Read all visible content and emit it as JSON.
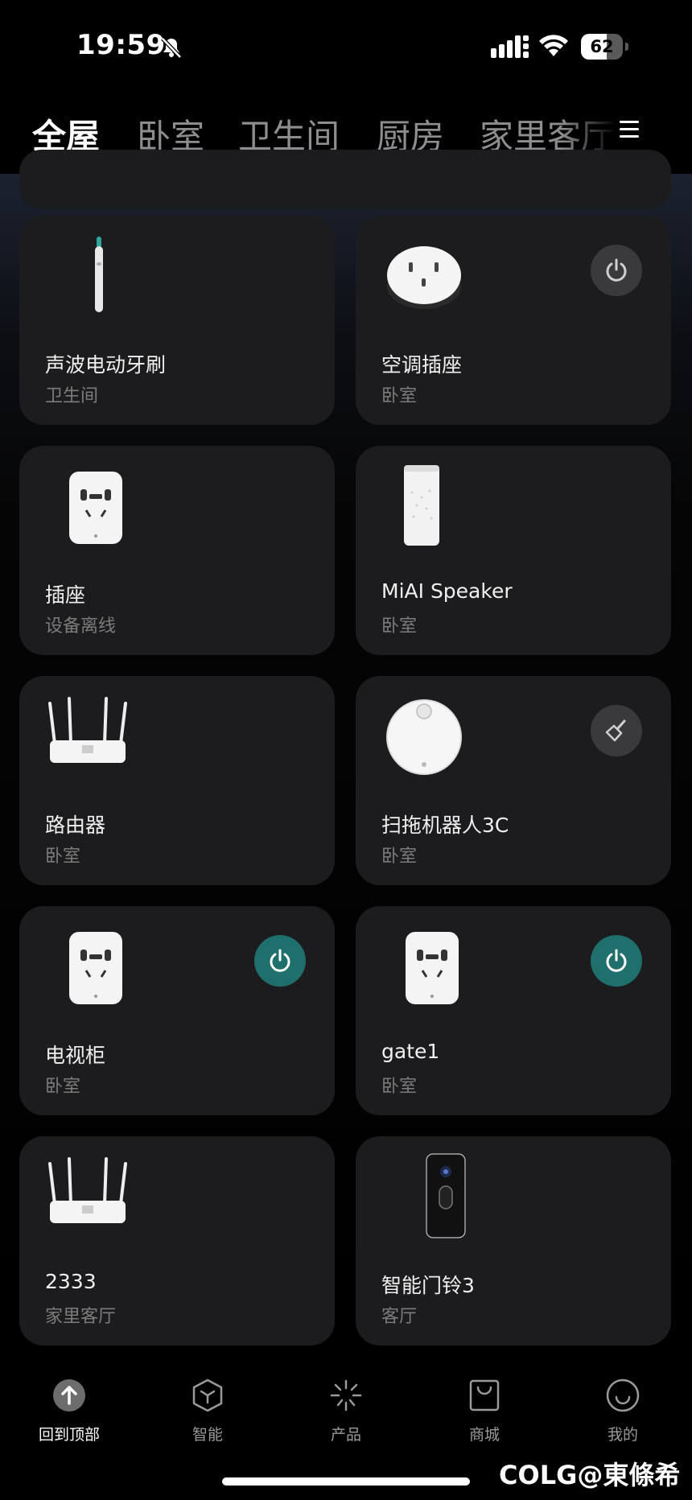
{
  "status_bar": {
    "time": "19:59",
    "battery": "62",
    "battery_level": 0.62
  },
  "tabs": [
    "全屋",
    "卧室",
    "卫生间",
    "厨房",
    "家里客厅"
  ],
  "devices": [
    {
      "name": "声波电动牙刷",
      "room": "卫生间",
      "icon": "toothbrush-icon",
      "control": "none"
    },
    {
      "name": "空调插座",
      "room": "卧室",
      "icon": "ac-plug-icon",
      "control": "power-off"
    },
    {
      "name": "插座",
      "room": "设备离线",
      "icon": "smart-plug-icon",
      "control": "none"
    },
    {
      "name": "MiAI Speaker",
      "room": "卧室",
      "icon": "speaker-icon",
      "control": "none"
    },
    {
      "name": "路由器",
      "room": "卧室",
      "icon": "router-icon",
      "control": "none"
    },
    {
      "name": "扫拖机器人3C",
      "room": "卧室",
      "icon": "robot-vacuum-icon",
      "control": "clean"
    },
    {
      "name": "电视柜",
      "room": "卧室",
      "icon": "smart-plug-icon",
      "control": "power-on"
    },
    {
      "name": "gate1",
      "room": "卧室",
      "icon": "smart-plug-icon",
      "control": "power-on"
    },
    {
      "name": "2333",
      "room": "家里客厅",
      "icon": "router-icon",
      "control": "none"
    },
    {
      "name": "智能门铃3",
      "room": "客厅",
      "icon": "doorbell-icon",
      "control": "none"
    }
  ],
  "bottom_nav": [
    {
      "label": "回到顶部",
      "icon": "arrow-up-icon"
    },
    {
      "label": "智能",
      "icon": "cube-icon"
    },
    {
      "label": "产品",
      "icon": "sparkle-icon"
    },
    {
      "label": "商城",
      "icon": "shopping-bag-icon"
    },
    {
      "label": "我的",
      "icon": "smiley-icon"
    }
  ],
  "watermark": "COLG@東條希",
  "colors": {
    "power_on": "#1f6f6c",
    "card": "#1c1c1e",
    "background": "#000000"
  }
}
